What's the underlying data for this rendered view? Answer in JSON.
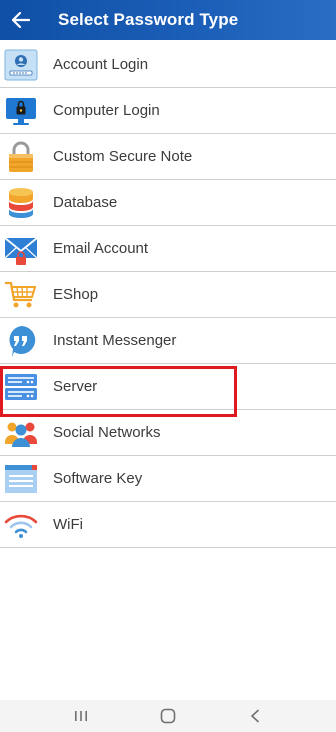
{
  "header": {
    "title": "Select Password Type",
    "back_icon": "arrow-left-icon"
  },
  "items": [
    {
      "label": "Account Login",
      "icon": "account-login-icon"
    },
    {
      "label": "Computer Login",
      "icon": "computer-login-icon"
    },
    {
      "label": "Custom Secure Note",
      "icon": "padlock-icon"
    },
    {
      "label": "Database",
      "icon": "database-icon"
    },
    {
      "label": "Email Account",
      "icon": "email-icon"
    },
    {
      "label": "EShop",
      "icon": "shopping-cart-icon"
    },
    {
      "label": "Instant Messenger",
      "icon": "chat-bubble-icon"
    },
    {
      "label": "Server",
      "icon": "server-icon",
      "highlighted": true
    },
    {
      "label": "Social Networks",
      "icon": "people-icon"
    },
    {
      "label": "Software Key",
      "icon": "software-key-icon"
    },
    {
      "label": "WiFi",
      "icon": "wifi-icon"
    }
  ],
  "colors": {
    "header": "#1c5fb8",
    "highlight": "#e0181f",
    "divider": "#cfcfcf"
  },
  "navbar": {
    "icons": [
      "recents-icon",
      "home-icon",
      "back-nav-icon"
    ]
  }
}
